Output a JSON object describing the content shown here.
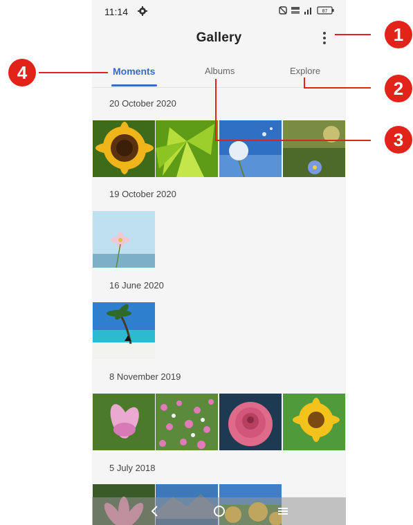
{
  "status": {
    "time": "11:14",
    "battery": "87"
  },
  "app": {
    "title": "Gallery"
  },
  "tabs": [
    {
      "label": "Moments"
    },
    {
      "label": "Albums"
    },
    {
      "label": "Explore"
    }
  ],
  "groups": [
    {
      "date": "20 October 2020"
    },
    {
      "date": "19 October 2020"
    },
    {
      "date": "16 June 2020"
    },
    {
      "date": "8 November 2019"
    },
    {
      "date": "5 July 2018"
    }
  ],
  "callouts": [
    "1",
    "2",
    "3",
    "4"
  ],
  "colors": {
    "accent": "#3a68c5",
    "callout": "#e2231a"
  }
}
